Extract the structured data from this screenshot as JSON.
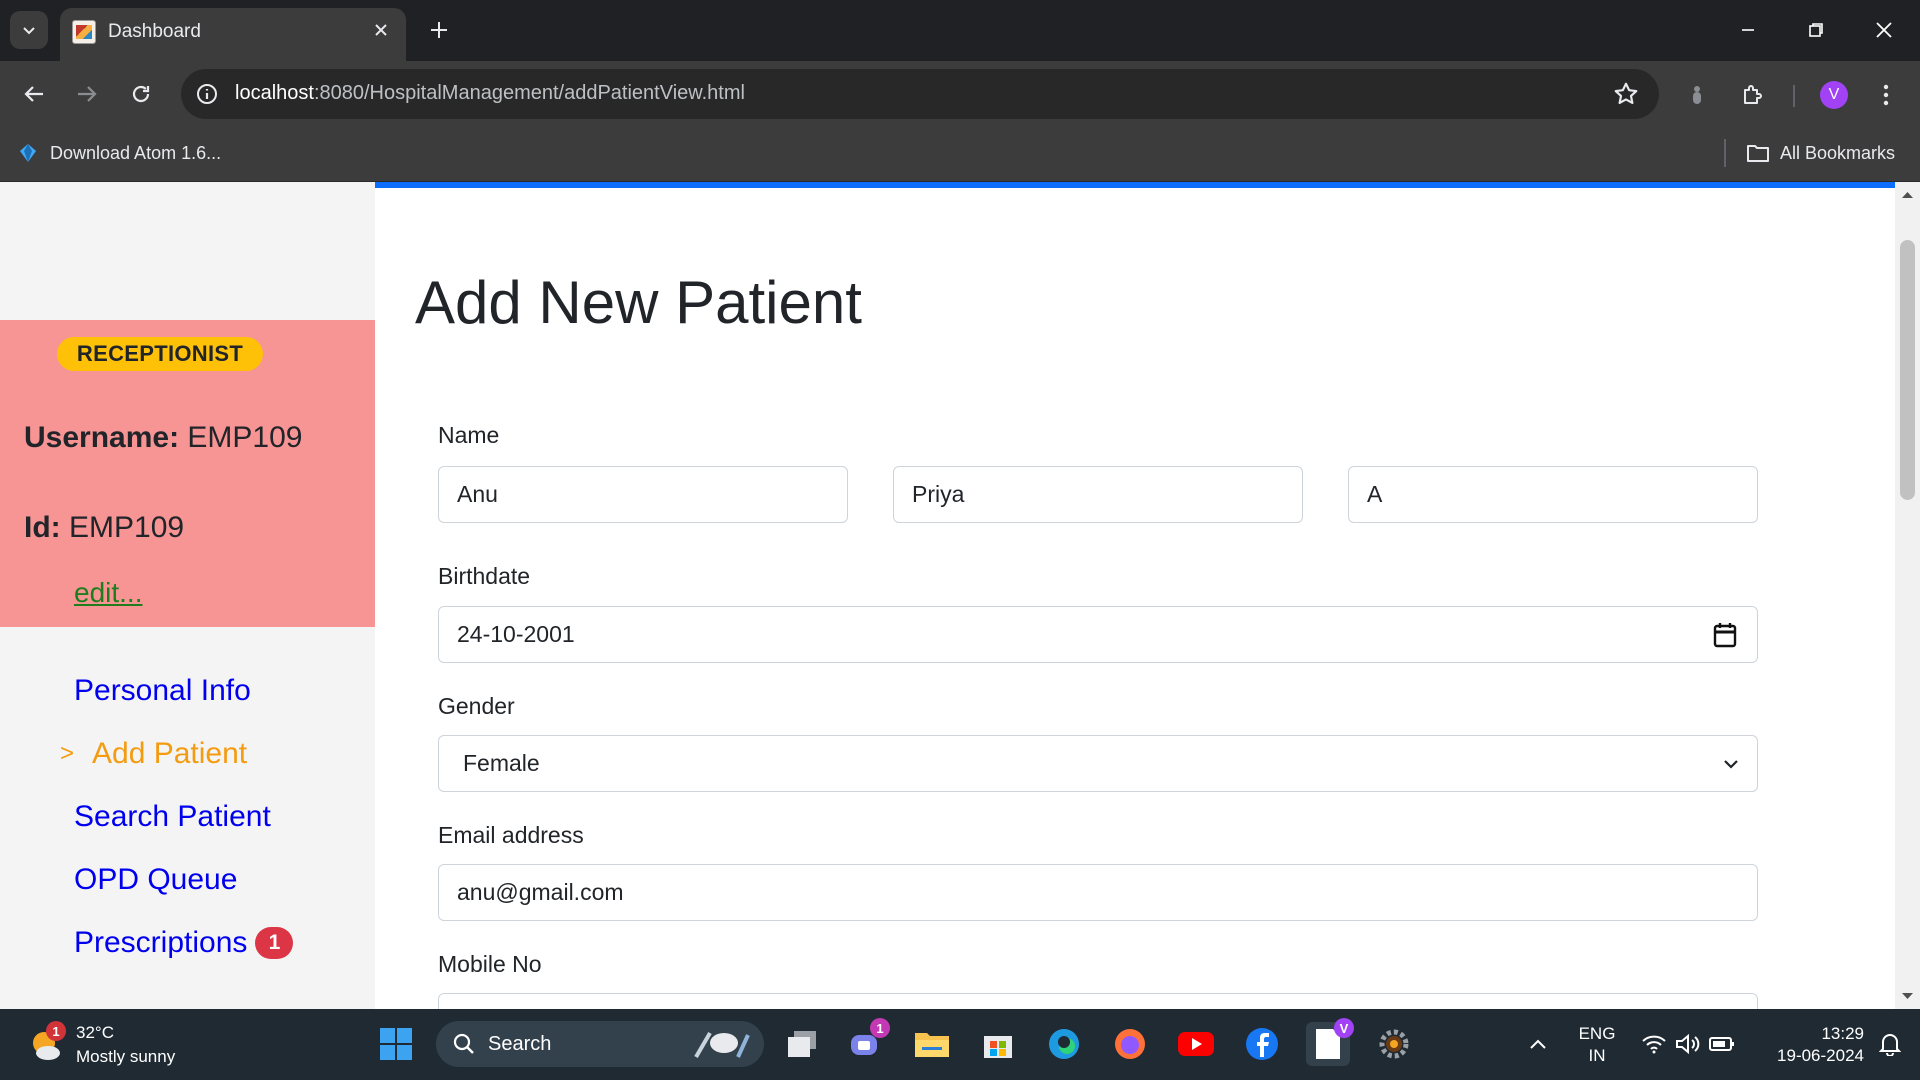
{
  "browser": {
    "tab_title": "Dashboard",
    "url_host": "localhost",
    "url_rest": ":8080/HospitalManagement/addPatientView.html",
    "avatar_letter": "V",
    "bookmarks": [
      {
        "label": "Download Atom 1.6..."
      }
    ],
    "all_bookmarks_label": "All Bookmarks"
  },
  "sidebar": {
    "role_badge": "RECEPTIONIST",
    "username_label": "Username:",
    "username_value": "EMP109",
    "id_label": "Id:",
    "id_value": "EMP109",
    "edit_link": "edit...",
    "active_marker": ">",
    "nav": [
      {
        "label": "Personal Info"
      },
      {
        "label": "Add Patient"
      },
      {
        "label": "Search Patient"
      },
      {
        "label": "OPD Queue"
      },
      {
        "label": "Prescriptions",
        "badge": "1"
      }
    ]
  },
  "form": {
    "title": "Add New Patient",
    "name_label": "Name",
    "first_name": "Anu",
    "middle_name": "Priya",
    "last_name": "A",
    "birthdate_label": "Birthdate",
    "birthdate": "24-10-2001",
    "gender_label": "Gender",
    "gender": "Female",
    "email_label": "Email address",
    "email": "anu@gmail.com",
    "mobile_label": "Mobile No"
  },
  "taskbar": {
    "temperature": "32°C",
    "weather": "Mostly sunny",
    "weather_badge": "1",
    "search_label": "Search",
    "teams_badge": "1",
    "lang_primary": "ENG",
    "lang_secondary": "IN",
    "time": "13:29",
    "date": "19-06-2024"
  },
  "colors": {
    "sidebar_card": "#f79494",
    "role_badge": "#ffc107",
    "nav_link": "#0000ee",
    "nav_active": "#f39c12",
    "accent_bar": "#0d6efd",
    "badge_red": "#dc3545"
  }
}
